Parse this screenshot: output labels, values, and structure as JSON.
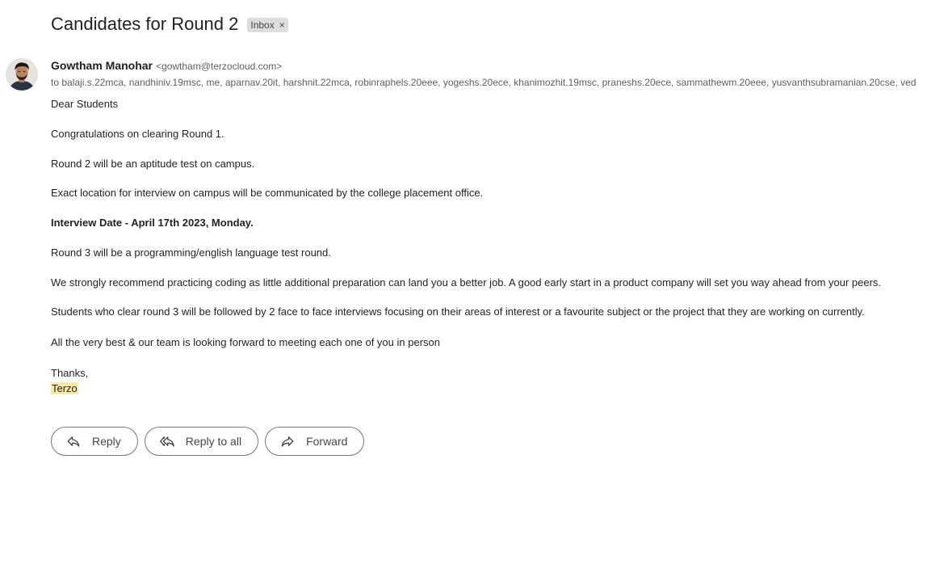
{
  "email": {
    "subject": "Candidates for Round 2",
    "label_chip": {
      "text": "Inbox",
      "close_glyph": "×"
    },
    "sender": {
      "name": "Gowtham Manohar",
      "email": "<gowtham@terzocloud.com>"
    },
    "recipients": "to balaji.s.22mca, nandhiniv.19msc, me, aparnav.20it, harshnit.22mca, robinraphels.20eee, yogeshs.20ece, khanimozhit.19msc, praneshs.20ece, sammathewm.20eee, yusvanthsubramanian.20cse, ved",
    "body": {
      "greeting": "Dear Students",
      "p1": "Congratulations on clearing Round 1.",
      "p2": "Round 2 will be an aptitude test on campus.",
      "p3": "Exact location for interview on campus will be communicated by the college placement office.",
      "p4": "Interview Date - April 17th 2023, Monday.",
      "p5": "Round 3 will be a programming/english language test round.",
      "p6": "We strongly recommend practicing coding as little additional preparation can land you a better job. A good early start in a product company will set you way ahead from your peers.",
      "p7": "Students who clear round 3 will be followed by 2 face to face interviews focusing on their areas of interest or a favourite subject or the project that they are working on currently.",
      "p8": "All the very best & our team is looking forward to meeting each one of you in person",
      "closing": "Thanks,",
      "signature": "Terzo"
    }
  },
  "actions": {
    "reply": "Reply",
    "reply_all": "Reply to all",
    "forward": "Forward"
  },
  "icons": {
    "avatar": "person-avatar",
    "reply": "reply-icon",
    "reply_all": "reply-all-icon",
    "forward": "forward-icon",
    "chip_close": "close-icon"
  },
  "colors": {
    "highlight": "#fce8a5",
    "chip_bg": "#dddddd"
  }
}
